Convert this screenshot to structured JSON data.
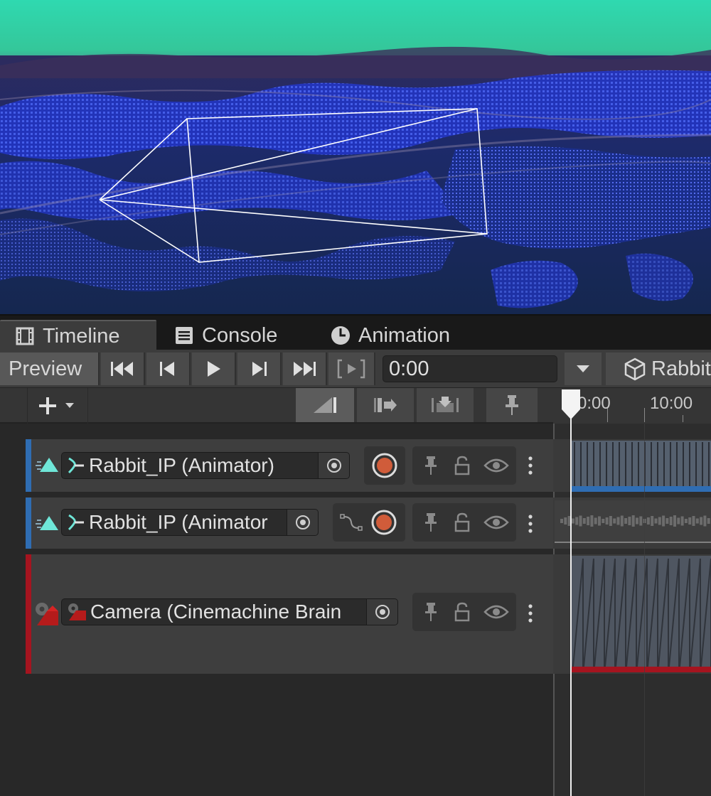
{
  "tabs": [
    {
      "label": "Timeline",
      "icon": "film-icon",
      "active": true
    },
    {
      "label": "Console",
      "icon": "console-icon",
      "active": false
    },
    {
      "label": "Animation",
      "icon": "clock-icon",
      "active": false
    }
  ],
  "toolbar": {
    "preview_label": "Preview",
    "time_value": "0:00",
    "binding_label": "Rabbit",
    "buttons": [
      "skip-to-start-icon",
      "previous-frame-icon",
      "play-icon",
      "next-frame-icon",
      "skip-to-end-icon",
      "play-range-icon",
      "dropdown-arrow-icon",
      "cube-icon"
    ]
  },
  "subbar": {
    "add_icon": "plus-icon",
    "buttons": [
      "clip-edit-mode-icon",
      "ripple-mode-icon",
      "replace-mode-icon",
      "pin-icon"
    ]
  },
  "ruler": {
    "labels": [
      "0:00",
      "10:00"
    ]
  },
  "tracks": [
    {
      "name": "Rabbit_IP (Animator)",
      "type": "animation",
      "accent": "#2f6db3"
    },
    {
      "name": "Rabbit_IP (Animator",
      "type": "animation",
      "accent": "#2f6db3"
    },
    {
      "name": "Camera (Cinemachine Brain",
      "type": "cinemachine",
      "accent": "#a5141f"
    }
  ],
  "colors": {
    "sky_top": "#2ed3a6",
    "points": "#3b52ff",
    "track_anim": "#2f6db3",
    "track_cam": "#a5141f",
    "record": "#d05c3a"
  }
}
